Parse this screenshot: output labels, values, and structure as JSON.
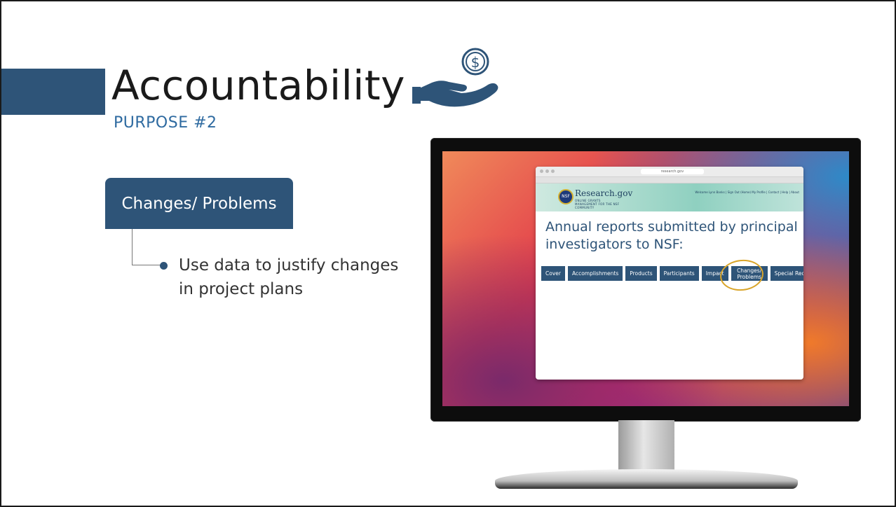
{
  "slide": {
    "title": "Accountability",
    "subtitle": "PURPOSE #2",
    "title_icon": "hand-coin-icon"
  },
  "card": {
    "label": "Changes/ Problems",
    "bullet": "Use data to justify changes in project plans"
  },
  "browser": {
    "url": "research.gov",
    "site_name": "Research.gov",
    "site_tagline": "ONLINE GRANTS MANAGEMENT FOR THE NSF COMMUNITY",
    "header_links": "Welcome Lynn Banks | Sign Out (Home) My Profile | Contact | Help | About",
    "heading": "Annual reports submitted by principal investigators to NSF:",
    "tabs": [
      {
        "label": "Cover"
      },
      {
        "label": "Accomplishments"
      },
      {
        "label": "Products"
      },
      {
        "label": "Participants"
      },
      {
        "label": "Impact"
      },
      {
        "label": "Changes/ Problems"
      },
      {
        "label": "Special Req's"
      }
    ],
    "highlighted_tab": "Changes/ Problems"
  },
  "colors": {
    "brand_navy": "#2e5478",
    "subtitle_blue": "#2e6aa0",
    "highlight_gold": "#d9a52a"
  }
}
